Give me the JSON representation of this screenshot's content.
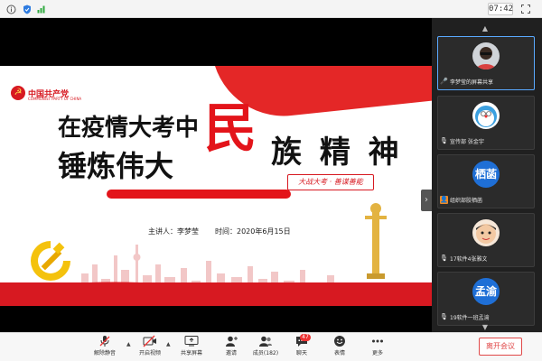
{
  "statusbar": {
    "info_icon": "info-icon",
    "shield_icon": "shield-icon",
    "signal_icon": "signal-icon",
    "time": "07:42",
    "fullscreen_icon": "fullscreen-icon"
  },
  "slide": {
    "party_name": "中国共产党",
    "party_sub": "COMMUNIST PARTY OF CHINA",
    "title_line1": "在疫情大考中",
    "title_line2": "锤炼伟大",
    "title_big": "民",
    "title_line3": "族 精 神",
    "slogan": "大战大考 · 善谋善能",
    "speaker": "主讲人：李梦莹",
    "time": "时间：2020年6月15日"
  },
  "participants": [
    {
      "label": "李梦莹的屏幕共享",
      "mic": "mic-icon",
      "avatar_text": ""
    },
    {
      "label": "宣传部 张金宇",
      "mic": "mic-muted-icon",
      "avatar_text": ""
    },
    {
      "label": "组织部胶栖菡",
      "mic": "mic-muted-icon",
      "avatar_text": "栖菡"
    },
    {
      "label": "17软件4张雅文",
      "mic": "mic-muted-icon",
      "avatar_text": ""
    },
    {
      "label": "19软件一班孟渝",
      "mic": "mic-muted-icon",
      "avatar_text": "孟渝"
    }
  ],
  "toolbar": {
    "mute": "解除静音",
    "video": "开启视频",
    "share": "共享屏幕",
    "invite": "邀请",
    "members": "成员(182)",
    "chat": "聊天",
    "chat_badge": "47",
    "reactions": "表情",
    "more": "更多",
    "leave": "离开会议"
  },
  "colors": {
    "accent_red": "#e3141a",
    "leave_red": "#e04848",
    "avatar_blue": "#1f6fd6"
  }
}
